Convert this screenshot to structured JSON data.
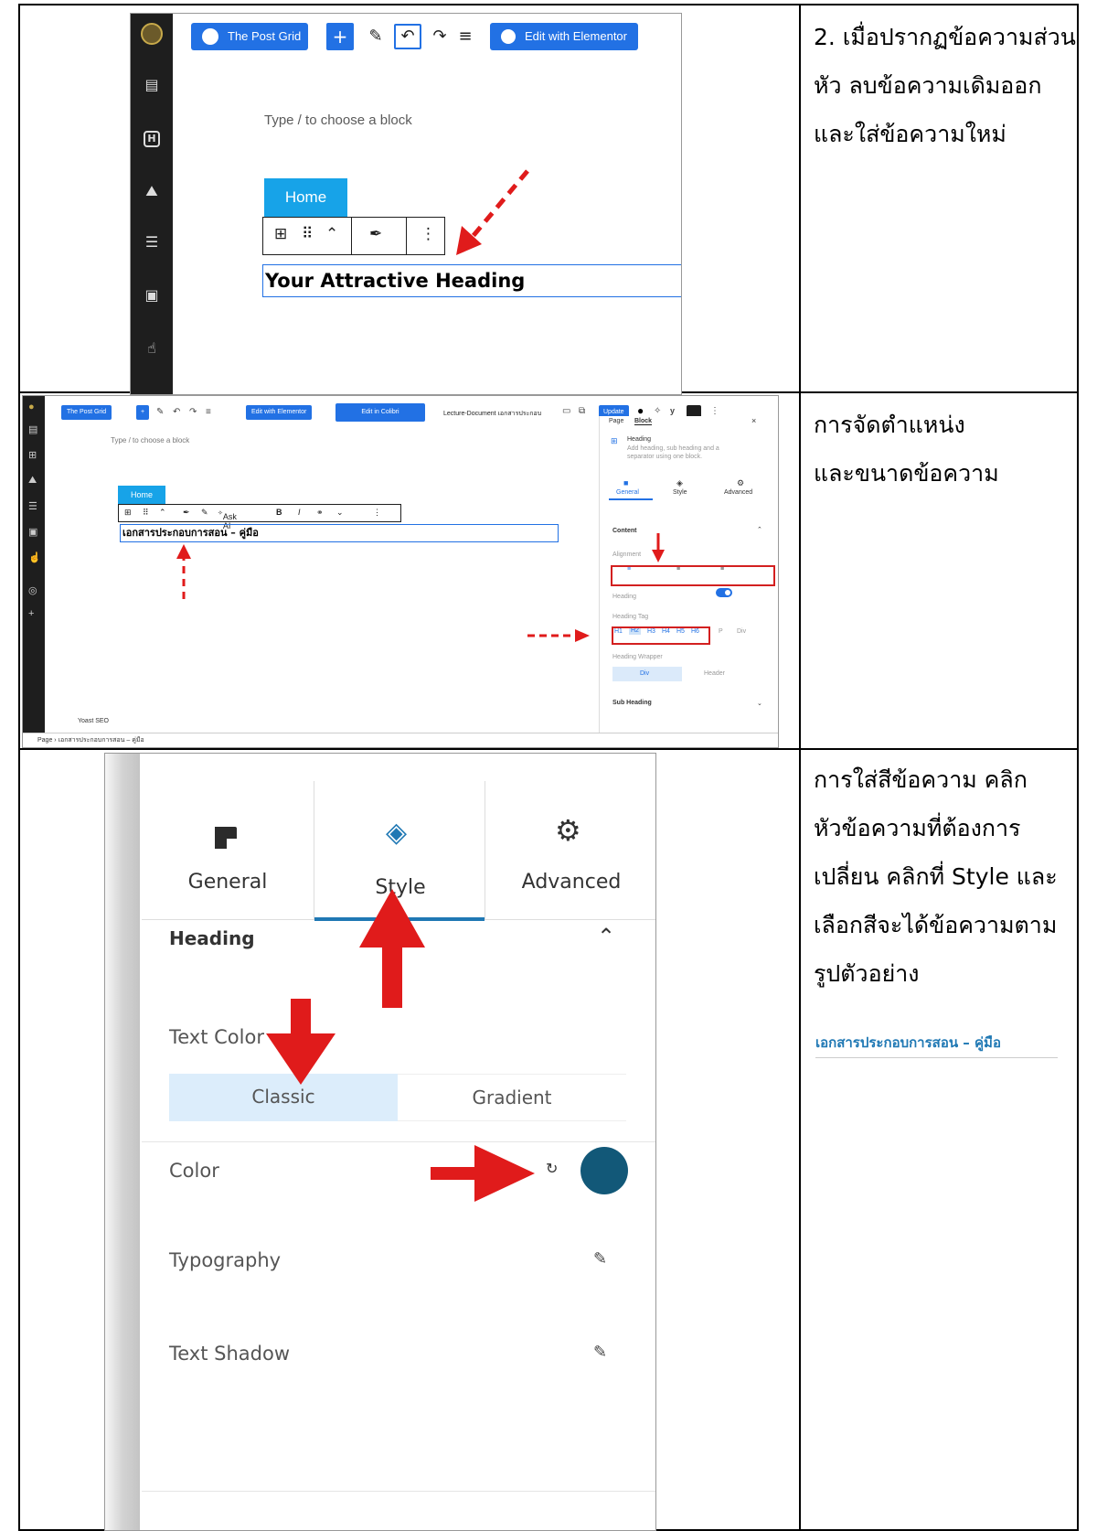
{
  "table": {
    "row1": {
      "description_lines": [
        "2. เมื่อปรากฏข้อความส่วน",
        "หัว ลบข้อความเดิมออก",
        "และใส่ข้อความใหม่"
      ]
    },
    "row2": {
      "description_lines": [
        "การจัดตำแหน่ง",
        "และขนาดข้อความ"
      ]
    },
    "row3": {
      "description_lines": [
        "การใส่สีข้อความ คลิก",
        "หัวข้อความที่ต้องการ",
        "เปลี่ยน คลิกที่ Style และ",
        "เลือกสีจะได้ข้อความตาม",
        "รูปตัวอย่าง"
      ],
      "sample_heading": "เอกสารประกอบการสอน – คู่มือ",
      "sample_color": "#1f78b4"
    }
  },
  "shot1": {
    "post_grid_label": "The Post Grid",
    "edit_elementor_label": "Edit with Elementor",
    "placeholder": "Type / to choose a block",
    "home_label": "Home",
    "heading_text": "Your Attractive Heading"
  },
  "shot2": {
    "post_grid_label": "The Post Grid",
    "edit_elementor_label": "Edit with Elementor",
    "edit_colibri_label": "Edit in Colibri",
    "doc_title": "Lecture-Document เอกสารประกอบ",
    "update_label": "Update",
    "placeholder": "Type / to choose a block",
    "home_label": "Home",
    "ask_ai_label": "Ask AI",
    "heading_text": "เอกสารประกอบการสอน – คู่มือ",
    "panel": {
      "tab_page": "Page",
      "tab_block": "Block",
      "block_name": "Heading",
      "block_desc_1": "Add heading, sub heading and a",
      "block_desc_2": "separator using one block.",
      "tab_general": "General",
      "tab_style": "Style",
      "tab_advanced": "Advanced",
      "content_label": "Content",
      "alignment_label": "Alignment",
      "heading_label": "Heading",
      "heading_tag_label": "Heading Tag",
      "tags": [
        "H1",
        "H2",
        "H3",
        "H4",
        "H5",
        "H6",
        "P",
        "Div"
      ],
      "wrapper_label": "Heading Wrapper",
      "wrapper_div": "Div",
      "wrapper_header": "Header",
      "sub_heading_label": "Sub Heading"
    },
    "yoast_label": "Yoast SEO",
    "breadcrumb_page": "Page",
    "breadcrumb_item": "เอกสารประกอบการสอน – คู่มือ"
  },
  "shot3": {
    "tab_general": "General",
    "tab_style": "Style",
    "tab_advanced": "Advanced",
    "heading_section": "Heading",
    "text_color_label": "Text Color",
    "classic_label": "Classic",
    "gradient_label": "Gradient",
    "color_label": "Color",
    "typography_label": "Typography",
    "text_shadow_label": "Text Shadow",
    "swatch_color": "#125878"
  },
  "colors": {
    "wp_blue": "#2271e4",
    "home_blue": "#17a3e8",
    "arrow_red": "#e01b1b",
    "style_blue": "#1f78b4"
  }
}
